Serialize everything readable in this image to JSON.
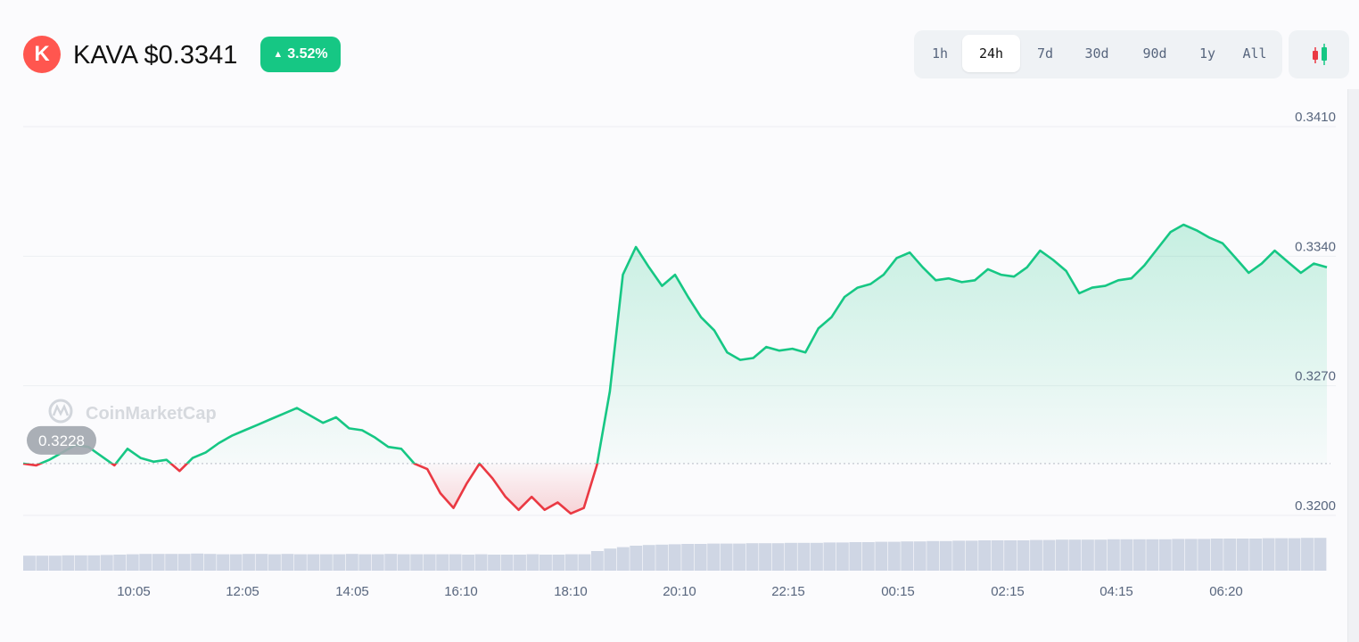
{
  "header": {
    "logo_letter": "K",
    "title": "KAVA $0.3341",
    "change": "3.52%",
    "change_arrow": "▲"
  },
  "range_tabs": [
    {
      "label": "1h",
      "active": false
    },
    {
      "label": "24h",
      "active": true
    },
    {
      "label": "7d",
      "active": false
    },
    {
      "label": "30d",
      "active": false
    },
    {
      "label": "90d",
      "active": false
    },
    {
      "label": "1y",
      "active": false
    },
    {
      "label": "All",
      "active": false
    }
  ],
  "chart_type_icon": "candlestick-icon",
  "watermark": "CoinMarketCap",
  "colors": {
    "up": "#16c784",
    "down": "#ea3943",
    "volume": "#cfd6e4",
    "grid": "#eceef2",
    "badge_bg": "#a3a8b0"
  },
  "chart_data": {
    "type": "line",
    "y_ticks": [
      "0.3410",
      "0.3340",
      "0.3270",
      "0.3200"
    ],
    "ylim": [
      0.3185,
      0.3418
    ],
    "x_tick_labels": [
      "10:05",
      "12:05",
      "14:05",
      "16:10",
      "18:10",
      "20:10",
      "22:15",
      "00:15",
      "02:15",
      "04:15",
      "06:20"
    ],
    "baseline_value": 0.3228,
    "baseline_label": "0.3228",
    "price_series": [
      0.3228,
      0.3227,
      0.323,
      0.3234,
      0.3238,
      0.3237,
      0.3232,
      0.3227,
      0.3236,
      0.3231,
      0.3229,
      0.323,
      0.3224,
      0.3231,
      0.3234,
      0.3239,
      0.3243,
      0.3246,
      0.3249,
      0.3252,
      0.3255,
      0.3258,
      0.3254,
      0.325,
      0.3253,
      0.3247,
      0.3246,
      0.3242,
      0.3237,
      0.3236,
      0.3228,
      0.3225,
      0.3212,
      0.3204,
      0.3217,
      0.3228,
      0.322,
      0.321,
      0.3203,
      0.321,
      0.3203,
      0.3207,
      0.3201,
      0.3204,
      0.3227,
      0.3267,
      0.333,
      0.3345,
      0.3334,
      0.3324,
      0.333,
      0.3318,
      0.3307,
      0.33,
      0.3288,
      0.3284,
      0.3285,
      0.3291,
      0.3289,
      0.329,
      0.3288,
      0.3301,
      0.3307,
      0.3318,
      0.3323,
      0.3325,
      0.333,
      0.3339,
      0.3342,
      0.3334,
      0.3327,
      0.3328,
      0.3326,
      0.3327,
      0.3333,
      0.333,
      0.3329,
      0.3334,
      0.3343,
      0.3338,
      0.3332,
      0.332,
      0.3323,
      0.3324,
      0.3327,
      0.3328,
      0.3335,
      0.3344,
      0.3353,
      0.3357,
      0.3354,
      0.335,
      0.3347,
      0.3339,
      0.3331,
      0.3336,
      0.3343,
      0.3337,
      0.3331,
      0.3336,
      0.3334
    ],
    "volume_series": [
      0.42,
      0.42,
      0.42,
      0.43,
      0.43,
      0.43,
      0.44,
      0.45,
      0.46,
      0.47,
      0.47,
      0.47,
      0.47,
      0.48,
      0.47,
      0.46,
      0.46,
      0.47,
      0.47,
      0.46,
      0.47,
      0.46,
      0.46,
      0.46,
      0.46,
      0.47,
      0.46,
      0.46,
      0.47,
      0.46,
      0.46,
      0.46,
      0.46,
      0.46,
      0.45,
      0.46,
      0.45,
      0.45,
      0.45,
      0.46,
      0.45,
      0.45,
      0.46,
      0.46,
      0.55,
      0.62,
      0.66,
      0.7,
      0.72,
      0.73,
      0.74,
      0.75,
      0.75,
      0.76,
      0.76,
      0.76,
      0.77,
      0.77,
      0.77,
      0.78,
      0.78,
      0.78,
      0.79,
      0.79,
      0.8,
      0.8,
      0.81,
      0.81,
      0.82,
      0.82,
      0.83,
      0.83,
      0.84,
      0.84,
      0.85,
      0.85,
      0.85,
      0.85,
      0.86,
      0.86,
      0.87,
      0.87,
      0.87,
      0.87,
      0.88,
      0.88,
      0.88,
      0.88,
      0.88,
      0.89,
      0.89,
      0.89,
      0.9,
      0.9,
      0.9,
      0.9,
      0.91,
      0.91,
      0.91,
      0.92,
      0.92
    ]
  }
}
